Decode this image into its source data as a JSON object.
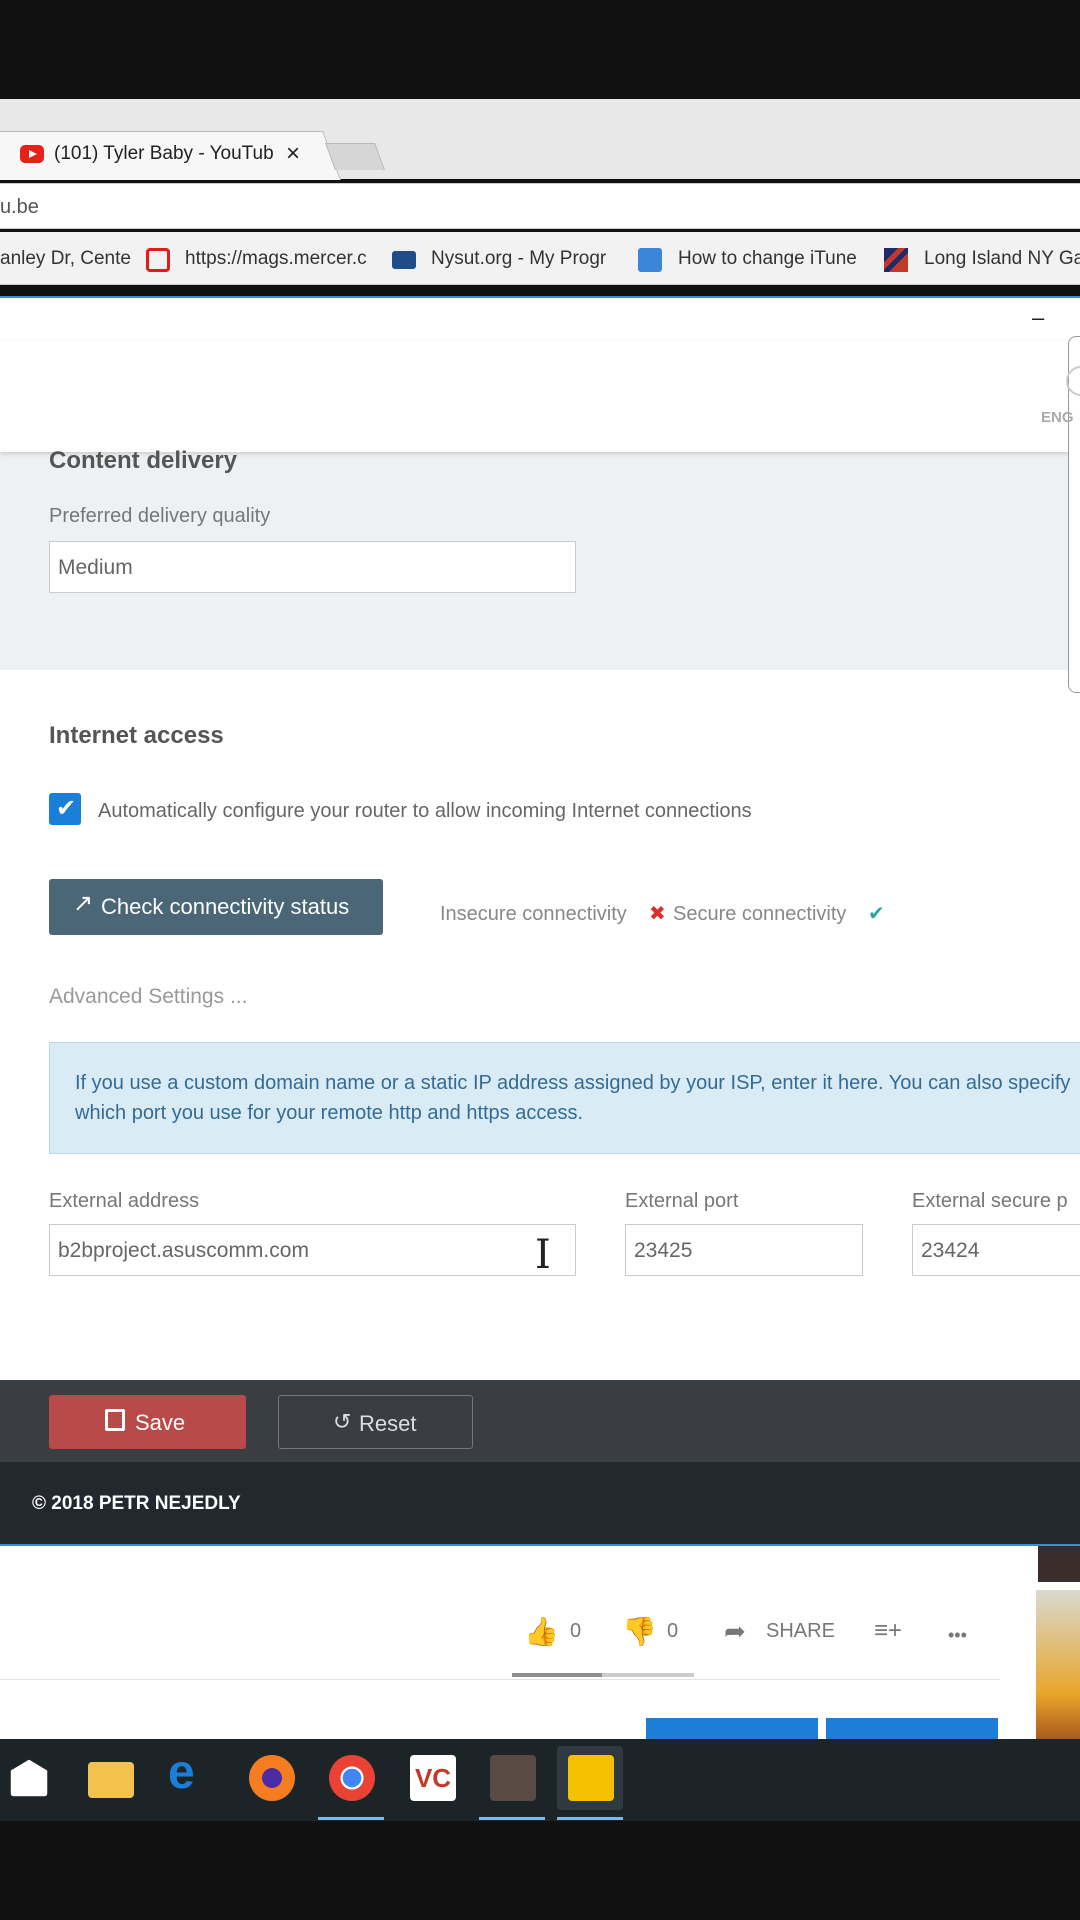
{
  "browser": {
    "tab_title": "(101) Tyler Baby - YouTub",
    "tab_close": "×",
    "address": "u.be",
    "bookmarks": [
      {
        "label": "anley Dr, Cente",
        "icon": "map-icon"
      },
      {
        "label": "https://mags.mercer.c",
        "icon": "oracle-icon"
      },
      {
        "label": "Nysut.org - My Progr",
        "icon": "nysut-icon"
      },
      {
        "label": "How to change iTune",
        "icon": "music-icon"
      },
      {
        "label": "Long Island NY Ga",
        "icon": "flag-icon"
      }
    ]
  },
  "app": {
    "minimize": "–",
    "language_label": "ENG",
    "content_delivery": {
      "heading": "Content delivery",
      "label": "Preferred delivery quality",
      "value": "Medium"
    },
    "internet_access": {
      "heading": "Internet access",
      "auto_config_label": "Automatically configure your router to allow incoming Internet connections",
      "auto_config_checked": true,
      "check_button": "Check connectivity status",
      "insecure_label": "Insecure connectivity",
      "insecure_status": "✖",
      "secure_label": "Secure connectivity",
      "secure_status": "✔",
      "advanced_link": "Advanced Settings ...",
      "info_text": "If you use a custom domain name or a static IP address assigned by your ISP, enter it here. You can also specify which port you use for your remote http and https access.",
      "external_address_label": "External address",
      "external_address": "b2bproject.asuscomm.com",
      "external_port_label": "External port",
      "external_port": "23425",
      "external_secure_port_label": "External secure p",
      "external_secure_port": "23424"
    },
    "save_label": "Save",
    "reset_label": "Reset",
    "footer": "© 2018 PETR NEJEDLY"
  },
  "youtube": {
    "likes": "0",
    "dislikes": "0",
    "share": "SHARE",
    "more": "•••"
  },
  "colors": {
    "accent": "#1a7fd8",
    "check_button": "#4a6677",
    "save_button": "#b84a4a",
    "info_bg": "#d9ecf6",
    "footer_bg": "#23272e"
  }
}
